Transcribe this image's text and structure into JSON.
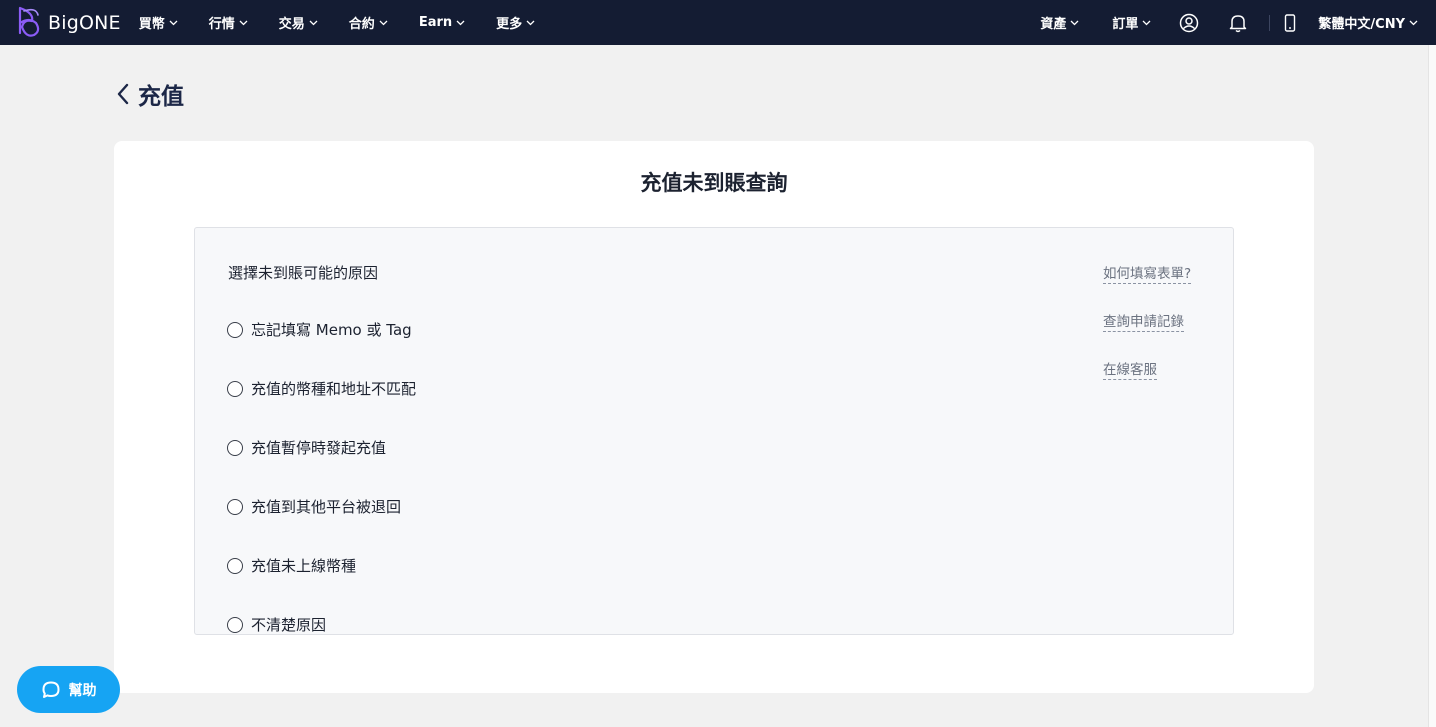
{
  "header": {
    "logo_text": "BigONE",
    "nav_left": [
      {
        "label": "買幣"
      },
      {
        "label": "行情"
      },
      {
        "label": "交易"
      },
      {
        "label": "合約"
      },
      {
        "label": "Earn"
      },
      {
        "label": "更多"
      }
    ],
    "nav_right": {
      "assets": "資產",
      "orders": "訂單",
      "language": "繁體中文/CNY"
    },
    "icons": [
      "user-circle-icon",
      "bell-icon",
      "mobile-phone-icon",
      "chevron-down-icon"
    ]
  },
  "page": {
    "title": "充值"
  },
  "card": {
    "title": "充值未到賬查詢",
    "question": "選擇未到賬可能的原因",
    "options": [
      {
        "label": "忘記填寫 Memo 或 Tag",
        "selected": false
      },
      {
        "label": "充值的幣種和地址不匹配",
        "selected": false
      },
      {
        "label": "充值暫停時發起充值",
        "selected": false
      },
      {
        "label": "充值到其他平台被退回",
        "selected": false
      },
      {
        "label": "充值未上線幣種",
        "selected": false
      },
      {
        "label": "不清楚原因",
        "selected": false
      }
    ],
    "links": [
      {
        "label": "如何填寫表單?"
      },
      {
        "label": "查詢申請記錄"
      },
      {
        "label": "在線客服"
      }
    ]
  },
  "help": {
    "label": "幫助"
  },
  "colors": {
    "topbar": "#141c33",
    "accent": "#16a4f3",
    "logo": "#8b5cf6"
  }
}
